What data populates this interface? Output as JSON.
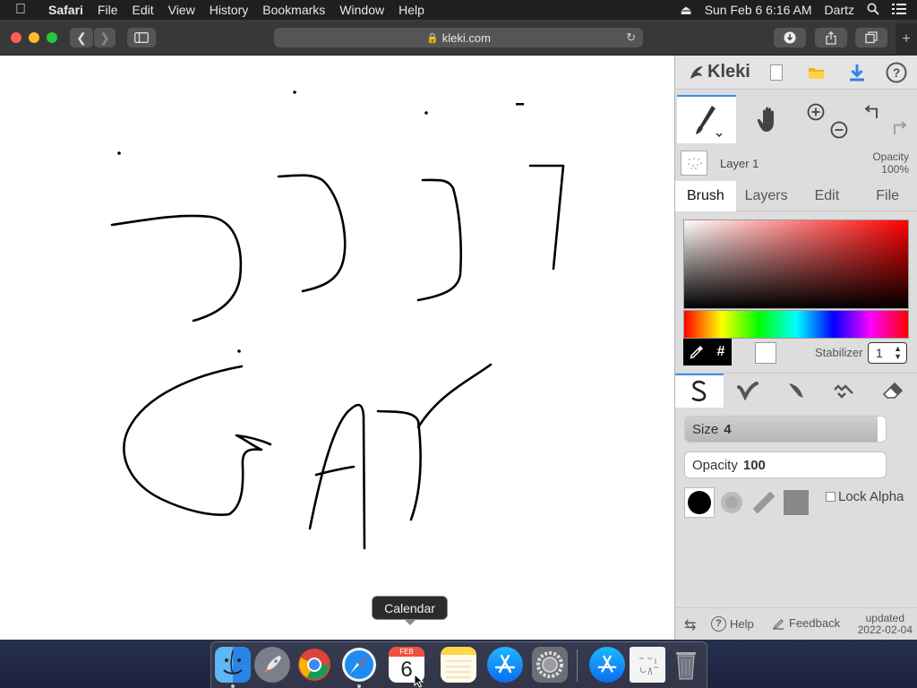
{
  "menubar": {
    "app_name": "Safari",
    "menus": [
      "File",
      "Edit",
      "View",
      "History",
      "Bookmarks",
      "Window",
      "Help"
    ],
    "datetime": "Sun Feb 6  6:16 AM",
    "user": "Dartz"
  },
  "browser": {
    "url": "kleki.com"
  },
  "kleki": {
    "logo_text": "Kleki",
    "layer": {
      "name": "Layer 1",
      "opacity_label": "Opacity",
      "opacity_value": "100%"
    },
    "tabs": [
      "Brush",
      "Layers",
      "Edit",
      "File"
    ],
    "active_tab": "Brush",
    "hash_label": "#",
    "stabilizer_label": "Stabilizer",
    "stabilizer_value": "1",
    "brush": {
      "size_label": "Size",
      "size_value": "4",
      "size_fraction": 0.96,
      "opacity_label": "Opacity",
      "opacity_value": "100",
      "opacity_fraction": 0.0,
      "lock_alpha_label": "Lock Alpha"
    },
    "footer": {
      "help_label": "Help",
      "feedback_label": "Feedback",
      "updated_label": "updated",
      "updated_date": "2022-02-04"
    },
    "colors": {
      "accent": "#3a8de8",
      "brush_color": "#000000",
      "secondary_color": "#ffffff"
    }
  },
  "dock": {
    "tooltip": "Calendar",
    "calendar_month": "FEB",
    "calendar_day": "6",
    "apps": [
      "Finder",
      "Launchpad",
      "Chrome",
      "Safari",
      "Calendar",
      "Notes",
      "App Store",
      "System Preferences",
      "App Store Downloads",
      "Kleki File",
      "Trash"
    ]
  }
}
